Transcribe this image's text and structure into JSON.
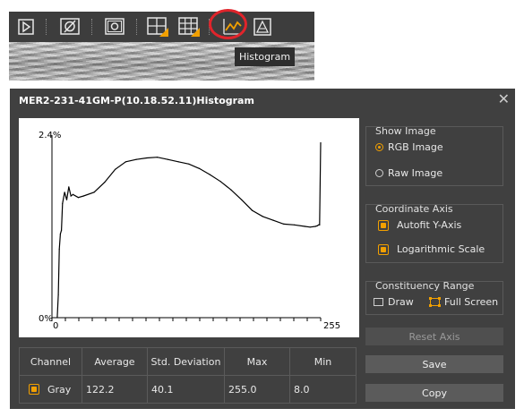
{
  "toolbar": {
    "buttons": [
      "play-icon",
      "no-crosshair-icon",
      "snapshot-icon",
      "crosshair-icon",
      "grid-icon",
      "histogram-icon",
      "triangle-icon"
    ],
    "tooltip": "Histogram",
    "highlight_color": "#e0242b",
    "background_color": "#3d3d3d"
  },
  "dialog": {
    "title": "MER2-231-41GM-P(10.18.52.11)Histogram",
    "close_glyph": "✕",
    "background_color": "#404040",
    "accent_color": "#f2a000"
  },
  "plot": {
    "y_top_label": "2.4%",
    "y_bottom_label": "0%",
    "x_left_label": "0",
    "x_right_label": "255"
  },
  "chart_data": {
    "type": "line",
    "title": "",
    "xlabel": "",
    "ylabel": "",
    "xlim": [
      0,
      255
    ],
    "ylim": [
      0,
      2.4
    ],
    "y_scale": "linear",
    "x_ticks": [
      "0",
      "255"
    ],
    "y_ticks": [
      "0%",
      "2.4%"
    ],
    "series": [
      {
        "x": [
          5,
          6,
          7,
          8,
          9,
          10,
          12,
          14,
          16,
          18,
          20,
          25,
          30,
          40,
          50,
          60,
          70,
          80,
          90,
          100,
          110,
          120,
          130,
          140,
          150,
          160,
          170,
          180,
          190,
          200,
          210,
          220,
          230,
          240,
          245,
          250,
          252,
          253,
          254,
          255
        ],
        "y": [
          0.0,
          0.3,
          0.9,
          1.1,
          1.15,
          1.5,
          1.65,
          1.55,
          1.72,
          1.6,
          1.62,
          1.58,
          1.6,
          1.65,
          1.78,
          1.95,
          2.05,
          2.08,
          2.1,
          2.11,
          2.08,
          2.05,
          2.02,
          1.96,
          1.88,
          1.79,
          1.68,
          1.55,
          1.41,
          1.33,
          1.28,
          1.23,
          1.22,
          1.2,
          1.19,
          1.2,
          1.21,
          1.22,
          1.22,
          2.3
        ]
      }
    ],
    "grid": false,
    "legend": "none"
  },
  "show_image": {
    "title": "Show Image",
    "options": [
      {
        "label": "RGB Image",
        "selected": true
      },
      {
        "label": "Raw Image",
        "selected": false
      }
    ]
  },
  "coordinate_axis": {
    "title": "Coordinate Axis",
    "options": [
      {
        "label": "Autofit Y-Axis",
        "checked": true
      },
      {
        "label": "Logarithmic Scale",
        "checked": true
      }
    ]
  },
  "constituency_range": {
    "title": "Constituency Range",
    "draw_label": "Draw",
    "fullscreen_label": "Full Screen"
  },
  "buttons": {
    "reset_axis": "Reset Axis",
    "save": "Save",
    "copy": "Copy"
  },
  "table": {
    "headers": [
      "Channel",
      "Average",
      "Std. Deviation",
      "Max",
      "Min"
    ],
    "row": {
      "channel": "Gray",
      "average": "122.2",
      "std": "40.1",
      "max": "255.0",
      "min": "8.0"
    }
  }
}
